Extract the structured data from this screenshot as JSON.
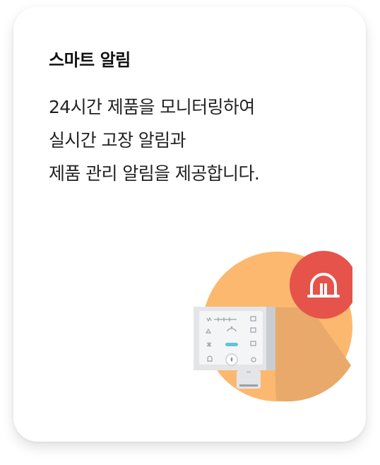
{
  "card": {
    "title": "스마트 알림",
    "description_lines": [
      "24시간 제품을 모니터링하여",
      "실시간 고장 알림과",
      "제품 관리 알림을 제공합니다."
    ]
  },
  "illustration": {
    "icons": [
      "water-purifier-icon",
      "alarm-siren-icon"
    ],
    "colors": {
      "circle": "#FCB86F",
      "circle_shadow": "#E9A96A",
      "alarm": "#E5534B",
      "device_body": "#E3E5E8",
      "device_panel": "#F4F5F7",
      "device_side": "#C9CCD1"
    }
  }
}
